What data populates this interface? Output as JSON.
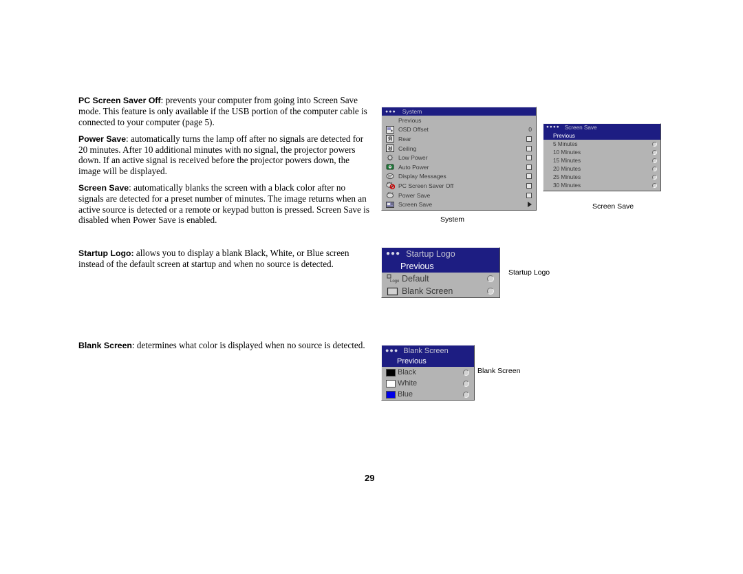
{
  "page": {
    "number": "29"
  },
  "body_text": {
    "paragraphs": [
      {
        "lead": "PC Screen Saver Off",
        "rest": ": prevents your computer from going into Screen Save mode. This feature is only available if the USB portion of the computer cable is connected to your computer (page 5)."
      },
      {
        "lead": "Power Save",
        "rest": ": automatically turns the lamp off after no signals are detected for 20 minutes. After 10 additional minutes with no signal, the projector powers down. If an active signal is received before the projector powers down, the image will be displayed."
      },
      {
        "lead": "Screen Save",
        "rest": ": automatically blanks the screen with a black color after no signals are detected for a preset number of minutes. The image returns when an active source is detected or a remote or keypad button is pressed. Screen Save is disabled when Power Save is enabled."
      },
      {
        "lead": "Startup Logo:",
        "rest": " allows you to display a blank Black, White, or Blue screen instead of the default screen at startup and when no source is detected."
      },
      {
        "lead": "Blank Screen",
        "rest": ": determines what color is displayed when no source is detected."
      }
    ]
  },
  "menus": {
    "system": {
      "title": "System",
      "dots": "●●●",
      "caption": "System",
      "previous_label": "Previous",
      "rows": [
        {
          "icon": "osd-offset-icon",
          "label": "OSD Offset",
          "control": "value",
          "value": "0"
        },
        {
          "icon": "rear-projection-icon",
          "label": "Rear",
          "control": "checkbox",
          "checked": false
        },
        {
          "icon": "ceiling-projection-icon",
          "label": "Ceiling",
          "control": "checkbox",
          "checked": false
        },
        {
          "icon": "low-power-lamp-icon",
          "label": "Low Power",
          "control": "checkbox",
          "checked": false
        },
        {
          "icon": "auto-power-icon",
          "label": "Auto Power",
          "control": "checkbox",
          "checked": false
        },
        {
          "icon": "display-messages-icon",
          "label": "Display Messages",
          "control": "checkbox",
          "checked": false
        },
        {
          "icon": "pc-screen-saver-off-icon",
          "label": "PC Screen Saver Off",
          "control": "checkbox",
          "checked": false
        },
        {
          "icon": "power-save-icon",
          "label": "Power Save",
          "control": "checkbox",
          "checked": false
        },
        {
          "icon": "screen-save-icon",
          "label": "Screen Save",
          "control": "submenu-arrow"
        }
      ]
    },
    "screen_save": {
      "title": "Screen Save",
      "dots": "●●●●",
      "caption": "Screen Save",
      "previous_label": "Previous",
      "options": [
        {
          "label": "5 Minutes",
          "selected": false
        },
        {
          "label": "10 Minutes",
          "selected": false
        },
        {
          "label": "15 Minutes",
          "selected": false
        },
        {
          "label": "20 Minutes",
          "selected": false
        },
        {
          "label": "25 Minutes",
          "selected": false
        },
        {
          "label": "30 Minutes",
          "selected": false
        }
      ]
    },
    "startup_logo": {
      "title": "Startup Logo",
      "dots": "●●●",
      "caption": "Startup Logo",
      "previous_label": "Previous",
      "options": [
        {
          "icon": "default-logo-icon",
          "label": "Default",
          "selected": false
        },
        {
          "icon": "blank-screen-icon",
          "label": "Blank Screen",
          "selected": false
        }
      ]
    },
    "blank_screen": {
      "title": "Blank Screen",
      "dots": "●●●",
      "caption": "Blank Screen",
      "previous_label": "Previous",
      "options": [
        {
          "swatch": "black-swatch",
          "color": "#000000",
          "label": "Black",
          "selected": false
        },
        {
          "swatch": "white-swatch",
          "color": "#ffffff",
          "label": "White",
          "selected": false
        },
        {
          "swatch": "blue-swatch",
          "color": "#0000e6",
          "label": "Blue",
          "selected": false
        }
      ]
    }
  },
  "colors": {
    "menu_titlebar": "#1d1d82",
    "menu_background": "#b4b4b4",
    "highlight": "#1d1d82",
    "text": "#3a3a3a"
  }
}
